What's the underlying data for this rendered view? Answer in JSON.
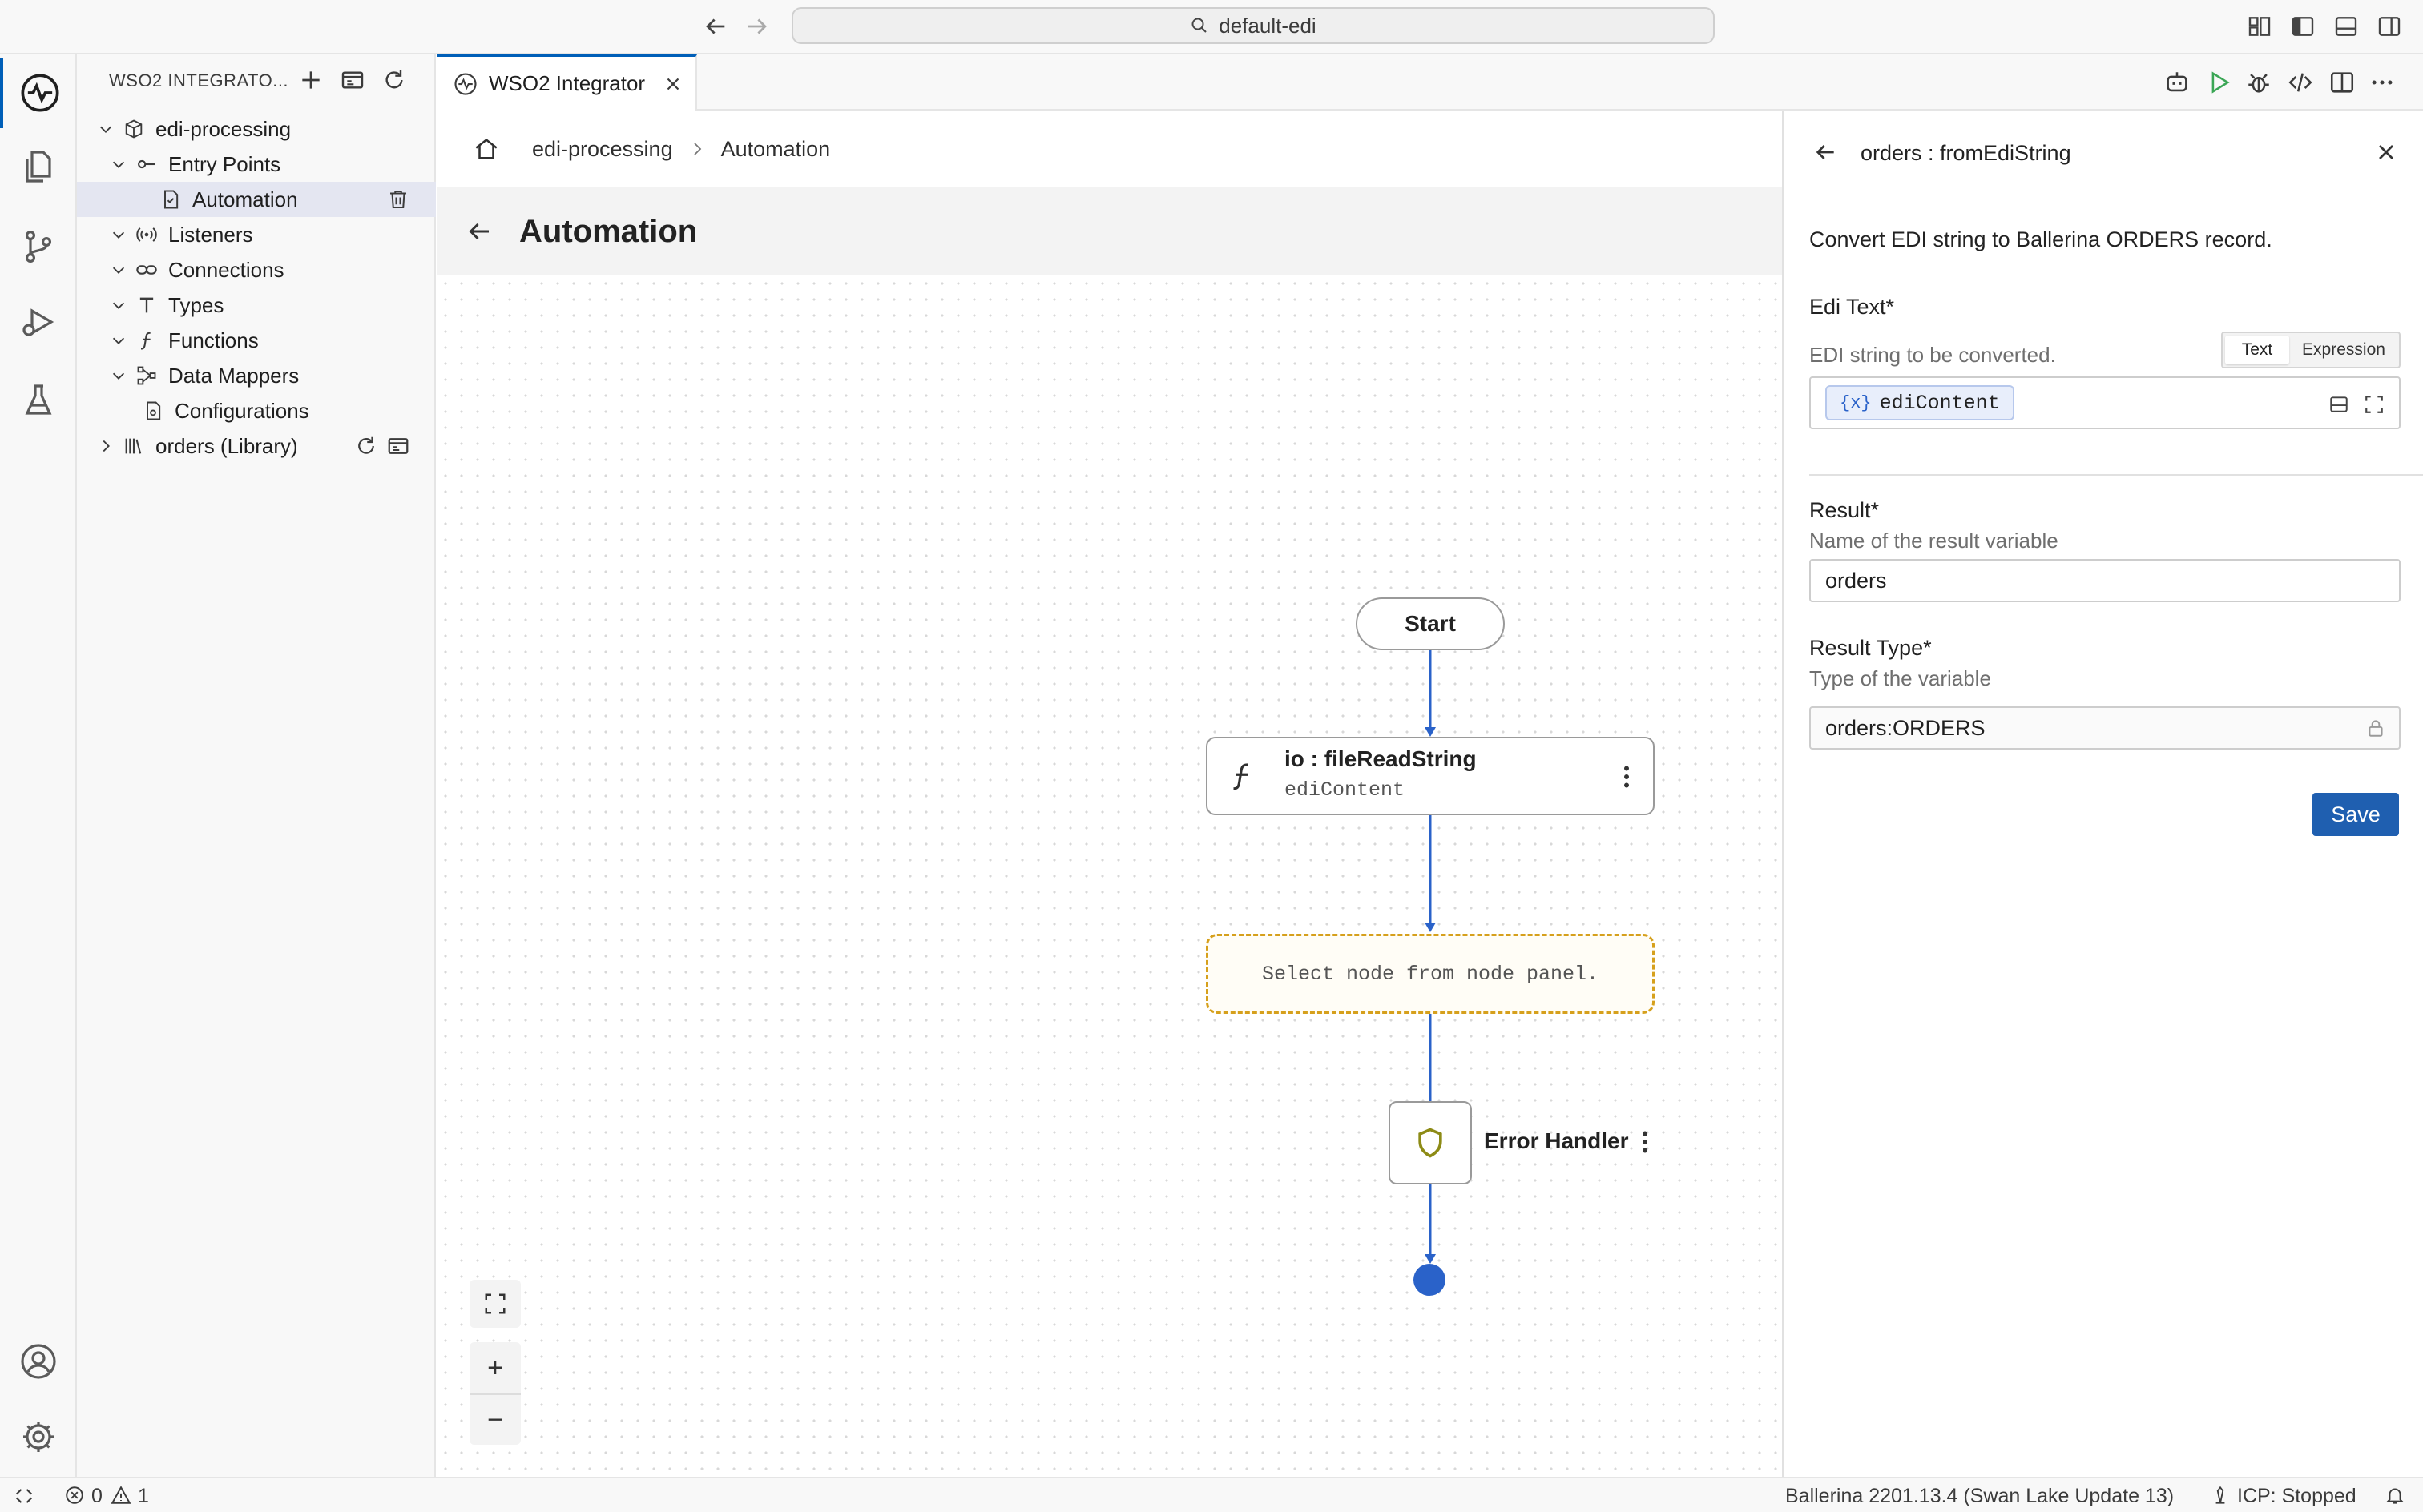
{
  "titlebar": {
    "command_center": "default-edi"
  },
  "explorer": {
    "title": "WSO2 INTEGRATO...",
    "tree": {
      "project": "edi-processing",
      "entry_points": "Entry Points",
      "automation": "Automation",
      "listeners": "Listeners",
      "connections": "Connections",
      "types": "Types",
      "functions": "Functions",
      "data_mappers": "Data Mappers",
      "configurations": "Configurations",
      "library": "orders (Library)"
    }
  },
  "tabs": [
    {
      "label": "WSO2 Integrator"
    }
  ],
  "designer": {
    "breadcrumb": [
      "edi-processing",
      "Automation"
    ],
    "title": "Automation",
    "flow": {
      "start": "Start",
      "func_title": "io : fileReadString",
      "func_subtitle": "ediContent",
      "empty_node": "Select node from node panel.",
      "error_handler": "Error Handler"
    },
    "zoom": {
      "in": "+",
      "out": "−"
    }
  },
  "panel": {
    "title": "orders : fromEdiString",
    "description": "Convert EDI string to Ballerina ORDERS record.",
    "edi_text": {
      "label": "Edi Text*",
      "hint": "EDI string to be converted.",
      "mode_text": "Text",
      "mode_expression": "Expression",
      "chip_prefix": "{x}",
      "chip_value": "ediContent"
    },
    "result": {
      "label": "Result*",
      "hint": "Name of the result variable",
      "value": "orders"
    },
    "result_type": {
      "label": "Result Type*",
      "hint": "Type of the variable",
      "value": "orders:ORDERS"
    },
    "save": "Save"
  },
  "statusbar": {
    "errors": "0",
    "warnings": "1",
    "ballerina": "Ballerina 2201.13.4 (Swan Lake Update 13)",
    "icp": "ICP: Stopped"
  },
  "colors": {
    "accent": "#005fb8",
    "save_button": "#1f5fb0",
    "flow_line": "#2a62c9",
    "empty_node_border": "#d6a01c",
    "error_shield": "#8d8b16"
  }
}
